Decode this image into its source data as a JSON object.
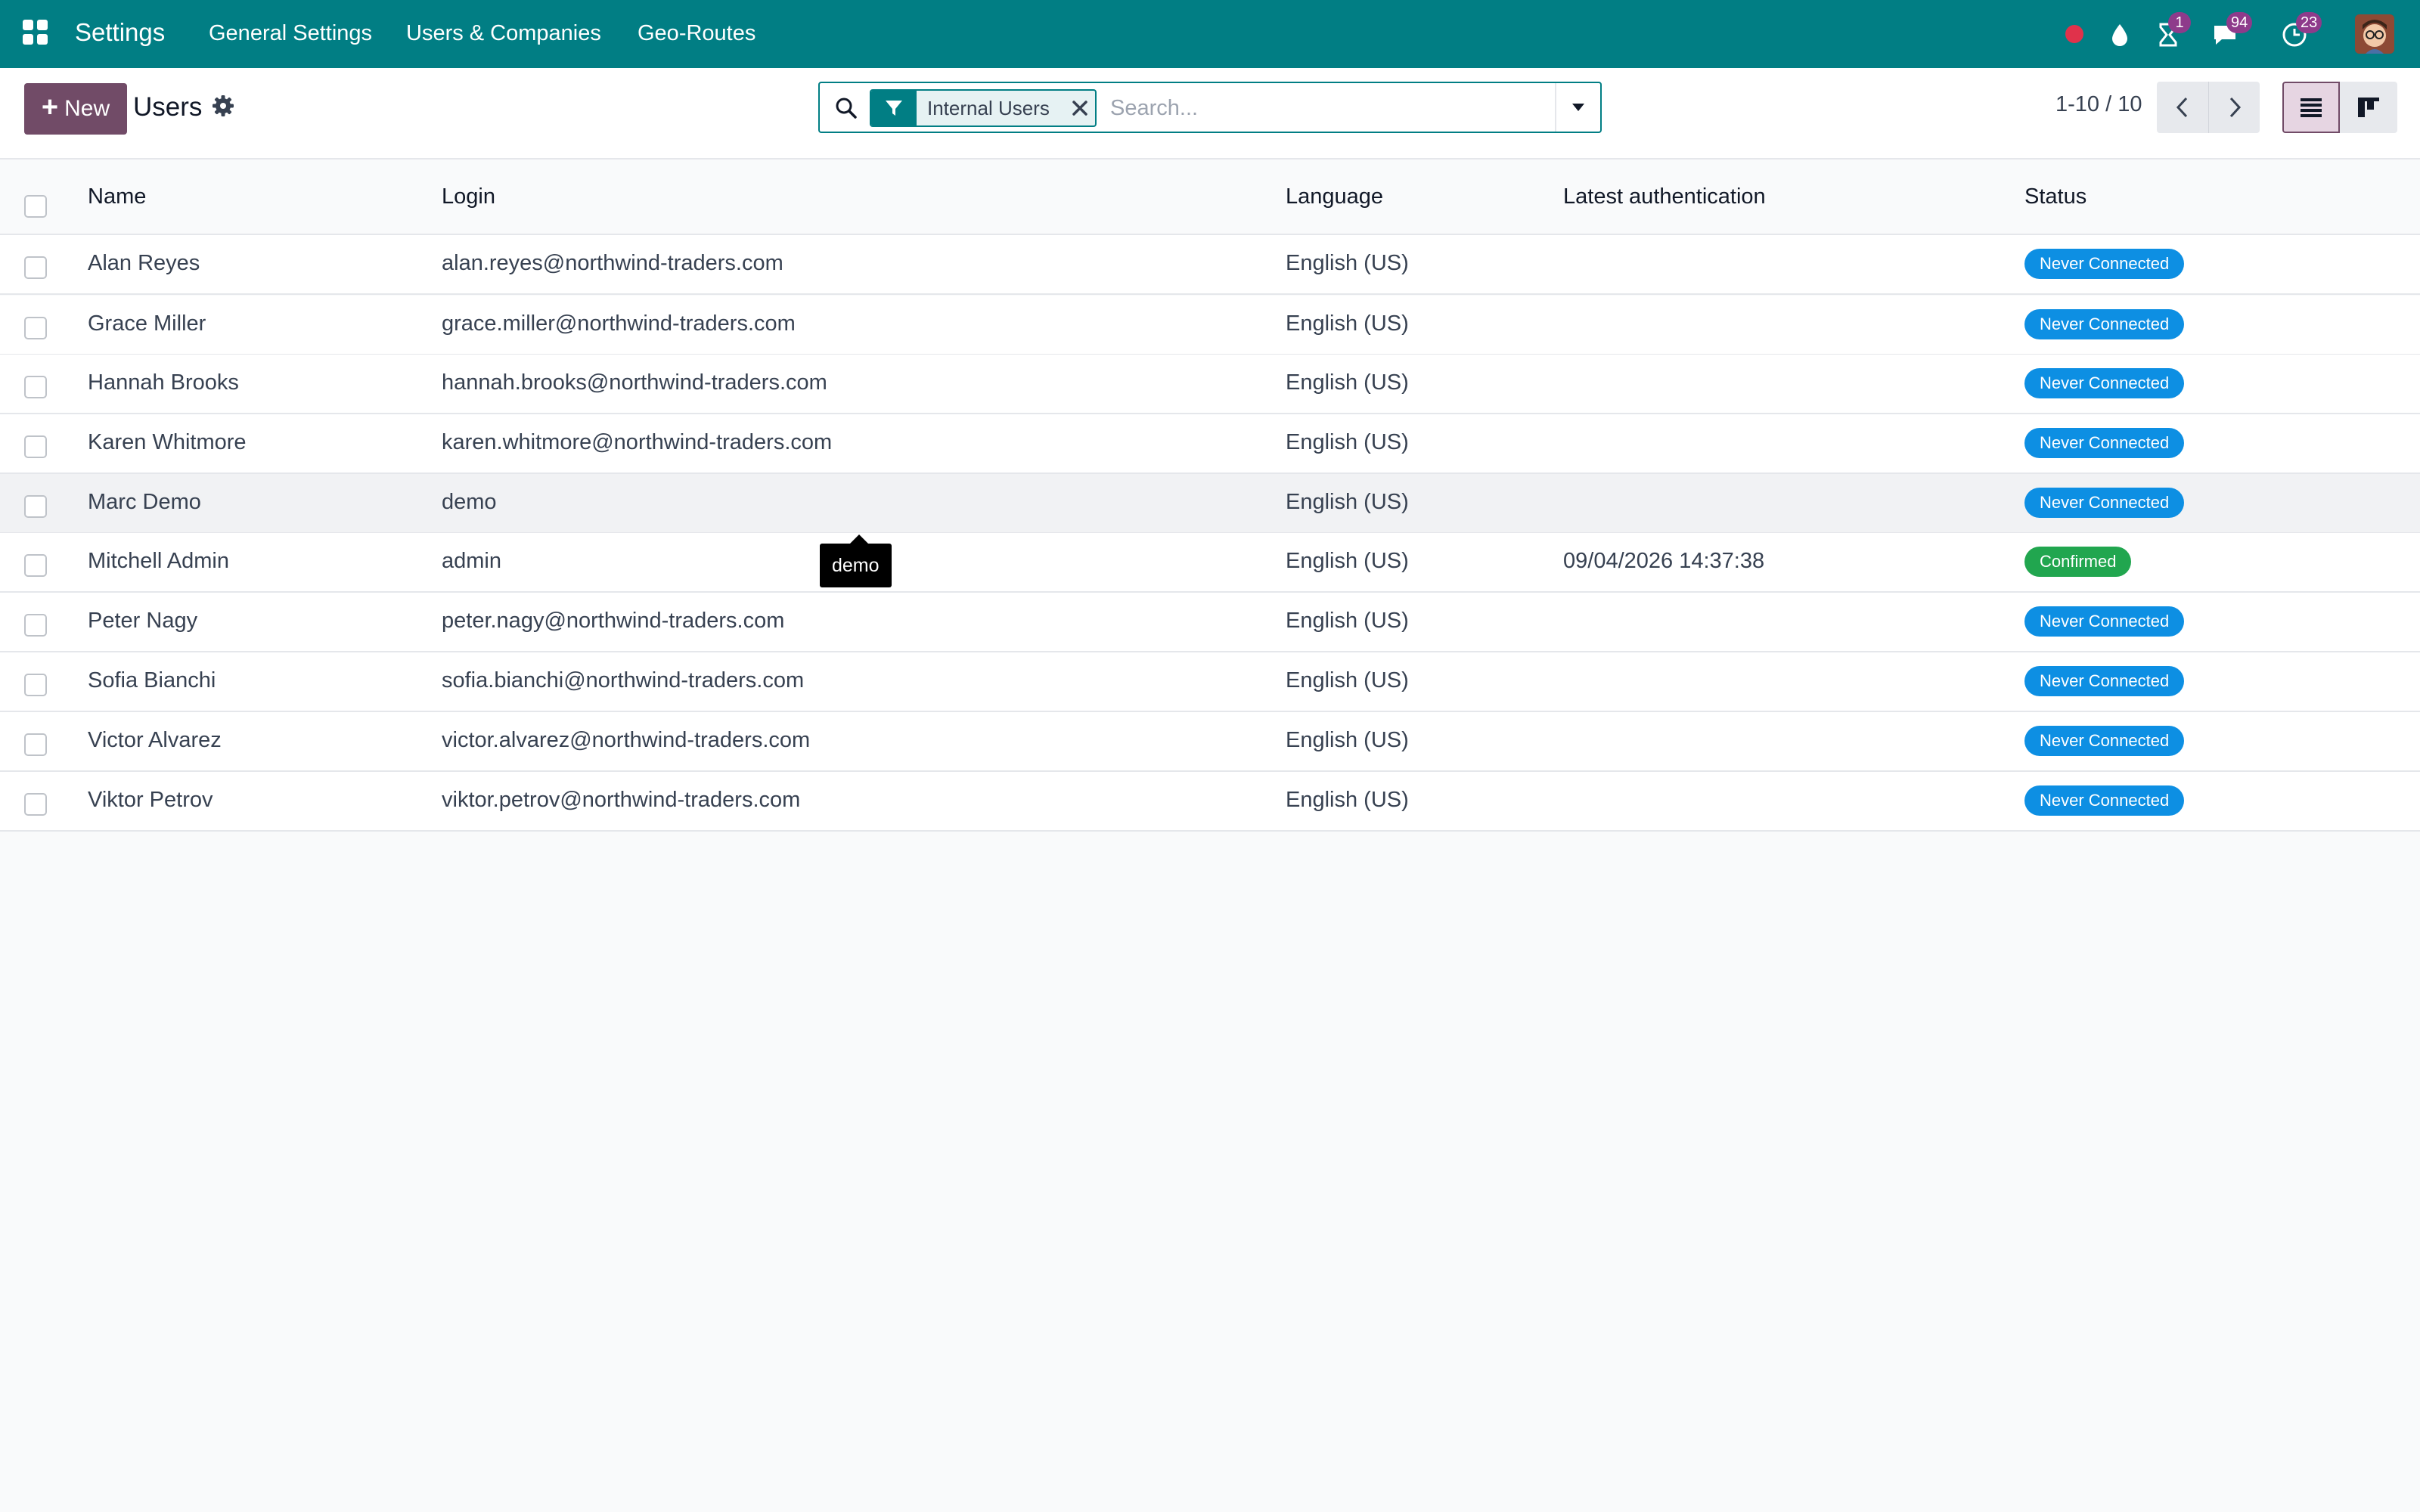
{
  "navbar": {
    "app_title": "Settings",
    "menus": [
      "General Settings",
      "Users & Companies",
      "Geo-Routes"
    ],
    "badges": {
      "activities": "1",
      "messages": "94",
      "clock": "23"
    },
    "color": "#017e84"
  },
  "control_panel": {
    "new_label": "New",
    "title": "Users",
    "search": {
      "facet_label": "Internal Users",
      "placeholder": "Search..."
    },
    "pager": "1-10 / 10"
  },
  "table": {
    "columns": [
      "Name",
      "Login",
      "Language",
      "Latest authentication",
      "Status"
    ],
    "rows": [
      {
        "name": "Alan Reyes",
        "login": "alan.reyes@northwind-traders.com",
        "language": "English (US)",
        "auth": "",
        "status": "Never Connected"
      },
      {
        "name": "Grace Miller",
        "login": "grace.miller@northwind-traders.com",
        "language": "English (US)",
        "auth": "",
        "status": "Never Connected"
      },
      {
        "name": "Hannah Brooks",
        "login": "hannah.brooks@northwind-traders.com",
        "language": "English (US)",
        "auth": "",
        "status": "Never Connected"
      },
      {
        "name": "Karen Whitmore",
        "login": "karen.whitmore@northwind-traders.com",
        "language": "English (US)",
        "auth": "",
        "status": "Never Connected"
      },
      {
        "name": "Marc Demo",
        "login": "demo",
        "language": "English (US)",
        "auth": "",
        "status": "Never Connected"
      },
      {
        "name": "Mitchell Admin",
        "login": "admin",
        "language": "English (US)",
        "auth": "09/04/2026 14:37:38",
        "status": "Confirmed"
      },
      {
        "name": "Peter Nagy",
        "login": "peter.nagy@northwind-traders.com",
        "language": "English (US)",
        "auth": "",
        "status": "Never Connected"
      },
      {
        "name": "Sofia Bianchi",
        "login": "sofia.bianchi@northwind-traders.com",
        "language": "English (US)",
        "auth": "",
        "status": "Never Connected"
      },
      {
        "name": "Victor Alvarez",
        "login": "victor.alvarez@northwind-traders.com",
        "language": "English (US)",
        "auth": "",
        "status": "Never Connected"
      },
      {
        "name": "Viktor Petrov",
        "login": "viktor.petrov@northwind-traders.com",
        "language": "English (US)",
        "auth": "",
        "status": "Never Connected"
      }
    ]
  },
  "tooltip": {
    "text": "demo"
  },
  "status_colors": {
    "Never Connected": "#0d8fe3",
    "Confirmed": "#21a64f"
  },
  "accent_color": "#714b67"
}
